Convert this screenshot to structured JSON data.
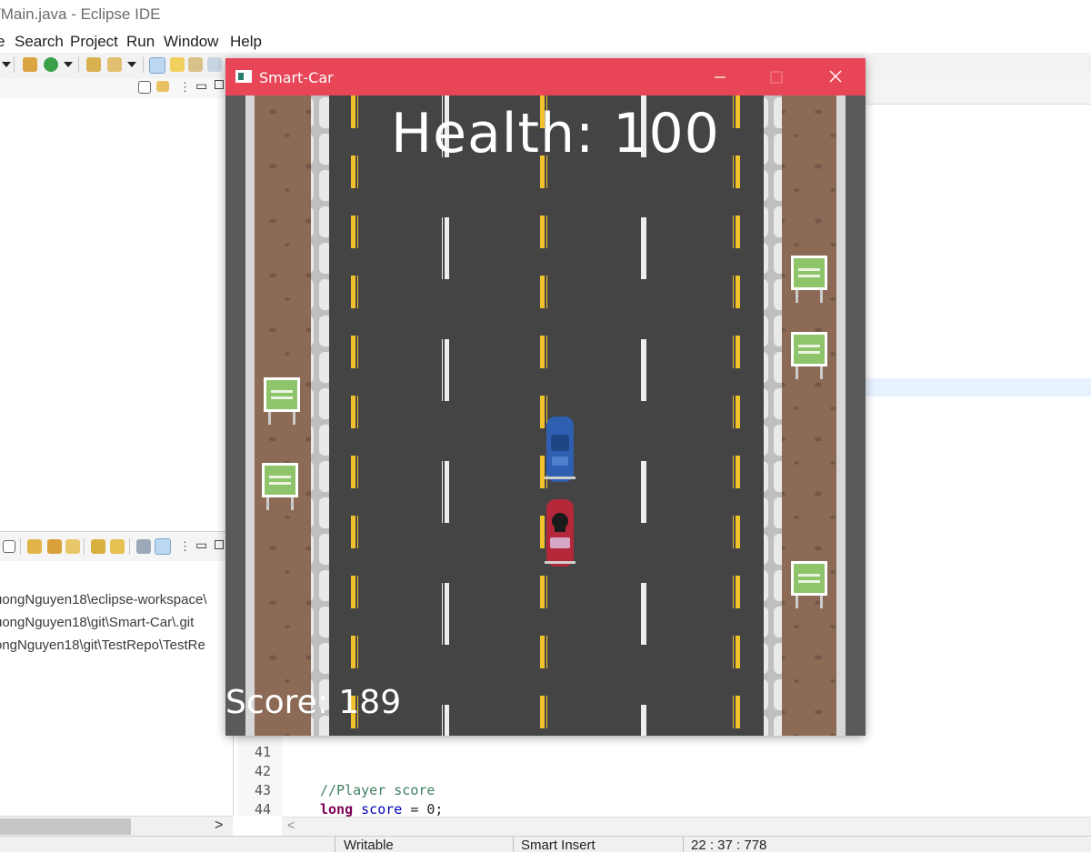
{
  "ide": {
    "title": "/Main.java - Eclipse IDE",
    "menu": [
      {
        "label": "e",
        "mnemonic": ""
      },
      {
        "label": "Search",
        "mnemonic": "S"
      },
      {
        "label": "Project",
        "mnemonic": "P"
      },
      {
        "label": "Run",
        "mnemonic": "R"
      },
      {
        "label": "Window",
        "mnemonic": "W"
      },
      {
        "label": "Help",
        "mnemonic": "H"
      }
    ]
  },
  "git_repositories": [
    "uongNguyen18\\eclipse-workspace\\",
    "uongNguyen18\\git\\Smart-Car\\.git",
    "ongNguyen18\\git\\TestRepo\\TestRe"
  ],
  "editor": {
    "lines": [
      {
        "number": "41",
        "text": ""
      },
      {
        "number": "42",
        "text": ""
      },
      {
        "number": "43",
        "text": "//Player score"
      },
      {
        "number": "44",
        "text": "long score = 0;"
      }
    ],
    "tokens": {
      "keyword": "long",
      "field": "score",
      "rest": " = 0;"
    }
  },
  "status_bar": {
    "mode": "Writable",
    "insert_mode": "Smart Insert",
    "position": "22 : 37 : 778"
  },
  "game_window": {
    "title": "Smart-Car",
    "title_bar_color": "#e84656",
    "health_label": "Health: 100",
    "score_label": "Score: 189",
    "player_car_color": "#2e5fb0",
    "enemy_car_color": "#b5283a"
  }
}
